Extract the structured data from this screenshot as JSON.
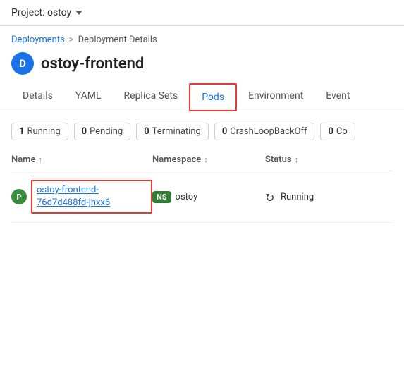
{
  "topbar": {
    "project_label": "Project: ostoy",
    "chevron": "▼"
  },
  "breadcrumb": {
    "link_label": "Deployments",
    "separator": ">",
    "current": "Deployment Details"
  },
  "page": {
    "badge_letter": "D",
    "title": "ostoy-frontend"
  },
  "tabs": [
    {
      "id": "details",
      "label": "Details",
      "active": false
    },
    {
      "id": "yaml",
      "label": "YAML",
      "active": false
    },
    {
      "id": "replica-sets",
      "label": "Replica Sets",
      "active": false
    },
    {
      "id": "pods",
      "label": "Pods",
      "active": true
    },
    {
      "id": "environment",
      "label": "Environment",
      "active": false
    },
    {
      "id": "events",
      "label": "Event",
      "active": false
    }
  ],
  "status_pills": [
    {
      "count": "1",
      "label": "Running"
    },
    {
      "count": "0",
      "label": "Pending"
    },
    {
      "count": "0",
      "label": "Terminating"
    },
    {
      "count": "0",
      "label": "CrashLoopBackOff"
    },
    {
      "count": "0",
      "label": "Co"
    }
  ],
  "table": {
    "columns": [
      {
        "label": "Name",
        "sortable": true
      },
      {
        "label": "Namespace",
        "sortable": true
      },
      {
        "label": "Status",
        "sortable": true
      }
    ],
    "rows": [
      {
        "name": "ostoy-frontend-76d7d488fd-jhxx6",
        "namespace": "ostoy",
        "ns_badge": "NS",
        "status": "Running"
      }
    ]
  }
}
